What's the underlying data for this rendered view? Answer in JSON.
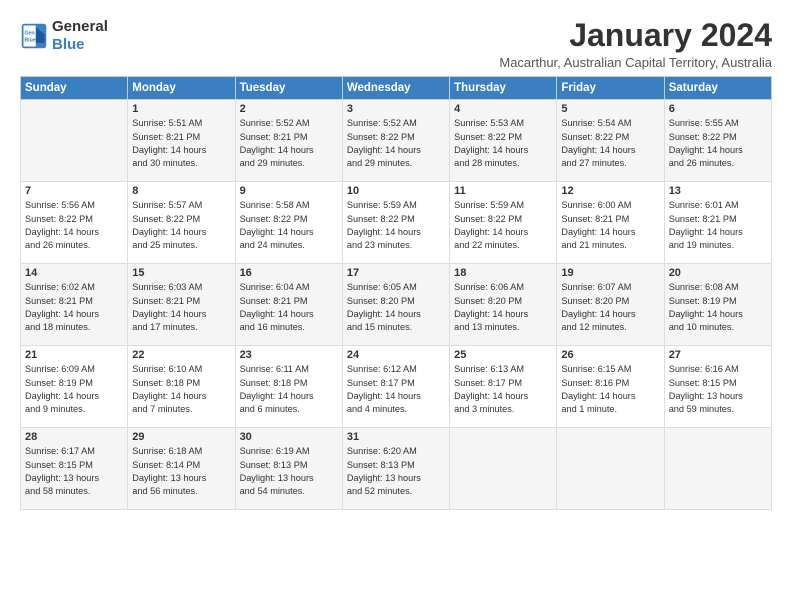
{
  "logo": {
    "general": "General",
    "blue": "Blue"
  },
  "header": {
    "month": "January 2024",
    "subtitle": "Macarthur, Australian Capital Territory, Australia"
  },
  "weekdays": [
    "Sunday",
    "Monday",
    "Tuesday",
    "Wednesday",
    "Thursday",
    "Friday",
    "Saturday"
  ],
  "weeks": [
    [
      {
        "day": "",
        "info": ""
      },
      {
        "day": "1",
        "info": "Sunrise: 5:51 AM\nSunset: 8:21 PM\nDaylight: 14 hours\nand 30 minutes."
      },
      {
        "day": "2",
        "info": "Sunrise: 5:52 AM\nSunset: 8:21 PM\nDaylight: 14 hours\nand 29 minutes."
      },
      {
        "day": "3",
        "info": "Sunrise: 5:52 AM\nSunset: 8:22 PM\nDaylight: 14 hours\nand 29 minutes."
      },
      {
        "day": "4",
        "info": "Sunrise: 5:53 AM\nSunset: 8:22 PM\nDaylight: 14 hours\nand 28 minutes."
      },
      {
        "day": "5",
        "info": "Sunrise: 5:54 AM\nSunset: 8:22 PM\nDaylight: 14 hours\nand 27 minutes."
      },
      {
        "day": "6",
        "info": "Sunrise: 5:55 AM\nSunset: 8:22 PM\nDaylight: 14 hours\nand 26 minutes."
      }
    ],
    [
      {
        "day": "7",
        "info": "Sunrise: 5:56 AM\nSunset: 8:22 PM\nDaylight: 14 hours\nand 26 minutes."
      },
      {
        "day": "8",
        "info": "Sunrise: 5:57 AM\nSunset: 8:22 PM\nDaylight: 14 hours\nand 25 minutes."
      },
      {
        "day": "9",
        "info": "Sunrise: 5:58 AM\nSunset: 8:22 PM\nDaylight: 14 hours\nand 24 minutes."
      },
      {
        "day": "10",
        "info": "Sunrise: 5:59 AM\nSunset: 8:22 PM\nDaylight: 14 hours\nand 23 minutes."
      },
      {
        "day": "11",
        "info": "Sunrise: 5:59 AM\nSunset: 8:22 PM\nDaylight: 14 hours\nand 22 minutes."
      },
      {
        "day": "12",
        "info": "Sunrise: 6:00 AM\nSunset: 8:21 PM\nDaylight: 14 hours\nand 21 minutes."
      },
      {
        "day": "13",
        "info": "Sunrise: 6:01 AM\nSunset: 8:21 PM\nDaylight: 14 hours\nand 19 minutes."
      }
    ],
    [
      {
        "day": "14",
        "info": "Sunrise: 6:02 AM\nSunset: 8:21 PM\nDaylight: 14 hours\nand 18 minutes."
      },
      {
        "day": "15",
        "info": "Sunrise: 6:03 AM\nSunset: 8:21 PM\nDaylight: 14 hours\nand 17 minutes."
      },
      {
        "day": "16",
        "info": "Sunrise: 6:04 AM\nSunset: 8:21 PM\nDaylight: 14 hours\nand 16 minutes."
      },
      {
        "day": "17",
        "info": "Sunrise: 6:05 AM\nSunset: 8:20 PM\nDaylight: 14 hours\nand 15 minutes."
      },
      {
        "day": "18",
        "info": "Sunrise: 6:06 AM\nSunset: 8:20 PM\nDaylight: 14 hours\nand 13 minutes."
      },
      {
        "day": "19",
        "info": "Sunrise: 6:07 AM\nSunset: 8:20 PM\nDaylight: 14 hours\nand 12 minutes."
      },
      {
        "day": "20",
        "info": "Sunrise: 6:08 AM\nSunset: 8:19 PM\nDaylight: 14 hours\nand 10 minutes."
      }
    ],
    [
      {
        "day": "21",
        "info": "Sunrise: 6:09 AM\nSunset: 8:19 PM\nDaylight: 14 hours\nand 9 minutes."
      },
      {
        "day": "22",
        "info": "Sunrise: 6:10 AM\nSunset: 8:18 PM\nDaylight: 14 hours\nand 7 minutes."
      },
      {
        "day": "23",
        "info": "Sunrise: 6:11 AM\nSunset: 8:18 PM\nDaylight: 14 hours\nand 6 minutes."
      },
      {
        "day": "24",
        "info": "Sunrise: 6:12 AM\nSunset: 8:17 PM\nDaylight: 14 hours\nand 4 minutes."
      },
      {
        "day": "25",
        "info": "Sunrise: 6:13 AM\nSunset: 8:17 PM\nDaylight: 14 hours\nand 3 minutes."
      },
      {
        "day": "26",
        "info": "Sunrise: 6:15 AM\nSunset: 8:16 PM\nDaylight: 14 hours\nand 1 minute."
      },
      {
        "day": "27",
        "info": "Sunrise: 6:16 AM\nSunset: 8:15 PM\nDaylight: 13 hours\nand 59 minutes."
      }
    ],
    [
      {
        "day": "28",
        "info": "Sunrise: 6:17 AM\nSunset: 8:15 PM\nDaylight: 13 hours\nand 58 minutes."
      },
      {
        "day": "29",
        "info": "Sunrise: 6:18 AM\nSunset: 8:14 PM\nDaylight: 13 hours\nand 56 minutes."
      },
      {
        "day": "30",
        "info": "Sunrise: 6:19 AM\nSunset: 8:13 PM\nDaylight: 13 hours\nand 54 minutes."
      },
      {
        "day": "31",
        "info": "Sunrise: 6:20 AM\nSunset: 8:13 PM\nDaylight: 13 hours\nand 52 minutes."
      },
      {
        "day": "",
        "info": ""
      },
      {
        "day": "",
        "info": ""
      },
      {
        "day": "",
        "info": ""
      }
    ]
  ]
}
